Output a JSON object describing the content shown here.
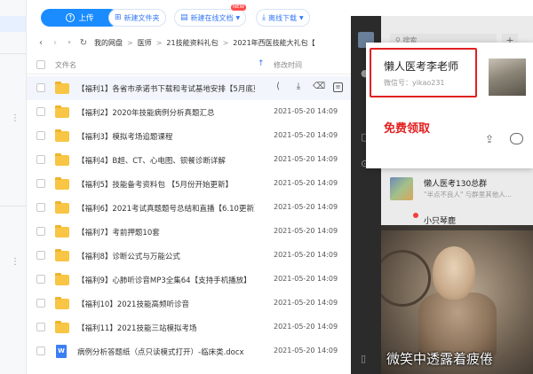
{
  "toolbar": {
    "upload_label": "上传",
    "new_folder_label": "新建文件夹",
    "new_online_doc_label": "新建在线文档",
    "new_badge": "NEW",
    "offline_download_label": "离线下载"
  },
  "breadcrumb": {
    "segments": [
      "我的网盘",
      "医师",
      "21技能资料礼包",
      "2021年西医技能大礼包【"
    ]
  },
  "table": {
    "col_name": "文件名",
    "col_time": "修改时间",
    "rows": [
      {
        "name": "【福利1】各省市承诺书下载和考试基地安排【5月底更...",
        "time": "",
        "type": "folder",
        "hover": true
      },
      {
        "name": "【福利2】2020年技能病例分析真题汇总",
        "time": "2021-05-20 14:09",
        "type": "folder"
      },
      {
        "name": "【福利3】模拟考场追题课程",
        "time": "2021-05-20 14:09",
        "type": "folder"
      },
      {
        "name": "【福利4】B超、CT、心电图、钡餐诊断详解",
        "time": "2021-05-20 14:09",
        "type": "folder"
      },
      {
        "name": "【福利5】技能备考资料包 【5月份开始更新】",
        "time": "2021-05-20 14:09",
        "type": "folder"
      },
      {
        "name": "【福利6】2021考试真题题号总结和直播【6.10更新】",
        "time": "2021-05-20 14:09",
        "type": "folder"
      },
      {
        "name": "【福利7】考前押题10套",
        "time": "2021-05-20 14:09",
        "type": "folder"
      },
      {
        "name": "【福利8】诊断公式与万能公式",
        "time": "2021-05-20 14:09",
        "type": "folder"
      },
      {
        "name": "【福利9】心肺听诊音MP3全集64【支持手机播放】",
        "time": "2021-05-20 14:09",
        "type": "folder"
      },
      {
        "name": "【福利10】2021技能高频听诊音",
        "time": "2021-05-20 14:09",
        "type": "folder"
      },
      {
        "name": "【福利11】2021技能三站模拟考场",
        "time": "2021-05-20 14:09",
        "type": "folder"
      },
      {
        "name": "病例分析答题纸（点只读模式打开）-临床类.docx",
        "time": "2021-05-20 14:09",
        "type": "doc"
      }
    ]
  },
  "chat": {
    "search_placeholder": "搜索",
    "profile_name": "懒人医考李老师",
    "profile_id": "微信号：yikao231",
    "claim_text": "免费领取",
    "conversations": [
      {
        "title": "懒人医考130总群",
        "subtitle": "\"半点不良人\" 与群里其他人..."
      },
      {
        "title": "小只琴鹿",
        "subtitle": ""
      }
    ],
    "photo_caption": "微笑中透露着疲倦"
  },
  "colors": {
    "accent": "#1a8cff",
    "folder": "#f8c545",
    "highlight_red": "#e02020",
    "chat_dark": "#2e2e2e"
  }
}
